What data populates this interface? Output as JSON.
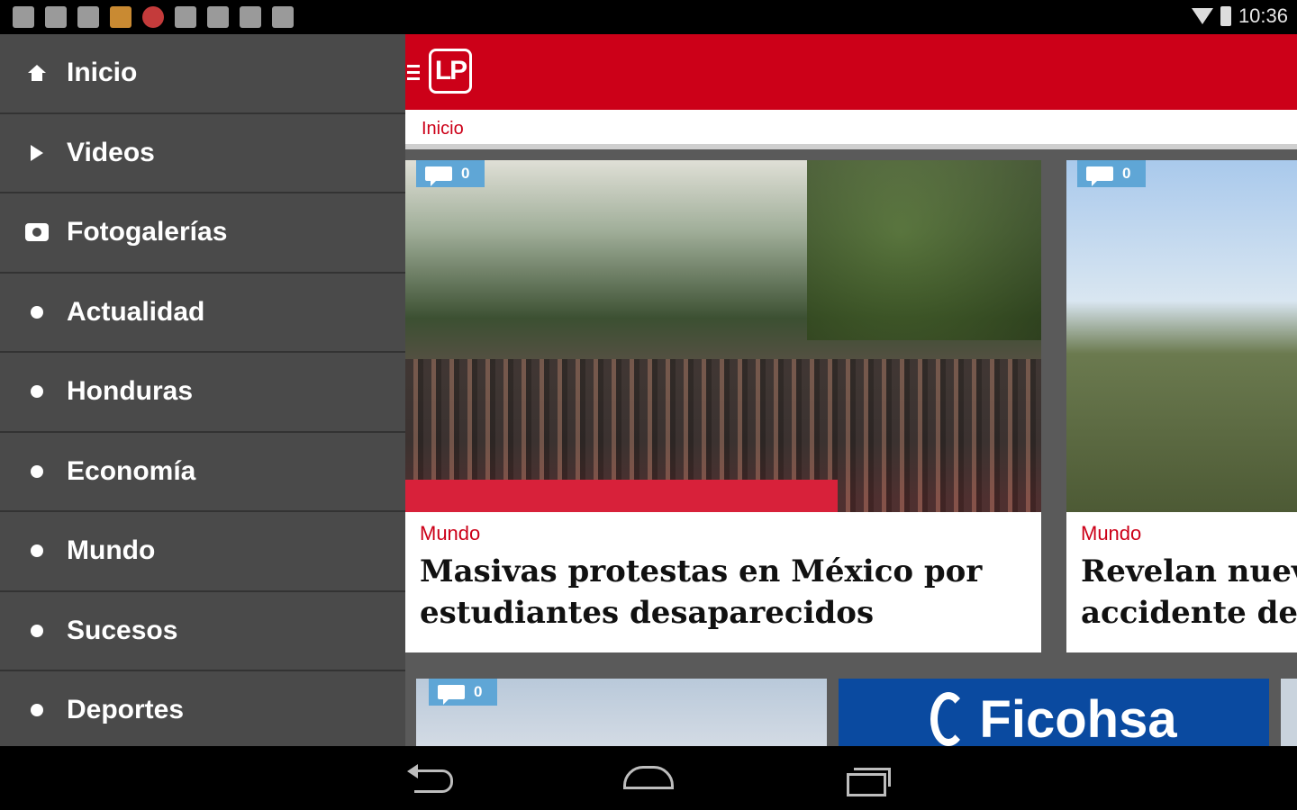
{
  "status_bar": {
    "time": "10:36",
    "notification_icons": [
      "settings-icon",
      "wifi-question-icon",
      "gmail-icon",
      "app-icon",
      "no-entry-icon",
      "camera-icon",
      "barcode-icon",
      "briefcase-icon",
      "clipboard-check-icon"
    ]
  },
  "drawer": {
    "items": [
      {
        "label": "Inicio",
        "icon": "home-icon"
      },
      {
        "label": "Videos",
        "icon": "play-icon"
      },
      {
        "label": "Fotogalerías",
        "icon": "camera-icon"
      },
      {
        "label": "Actualidad",
        "icon": "dot-icon"
      },
      {
        "label": "Honduras",
        "icon": "dot-icon"
      },
      {
        "label": "Economía",
        "icon": "dot-icon"
      },
      {
        "label": "Mundo",
        "icon": "dot-icon"
      },
      {
        "label": "Sucesos",
        "icon": "dot-icon"
      },
      {
        "label": "Deportes",
        "icon": "dot-icon"
      }
    ]
  },
  "header": {
    "logo_text": "LP",
    "accent_color": "#cc0018"
  },
  "breadcrumb": "Inicio",
  "articles": [
    {
      "category": "Mundo",
      "title_line1": "Masivas protestas en México por",
      "title_line2": "estudiantes desaparecidos",
      "comments": "0"
    },
    {
      "category": "Mundo",
      "title_line1": "Revelan nuev",
      "title_line2": "accidente del",
      "comments": "0"
    },
    {
      "comments": "0"
    }
  ],
  "ad": {
    "brand": "Ficohsa"
  }
}
